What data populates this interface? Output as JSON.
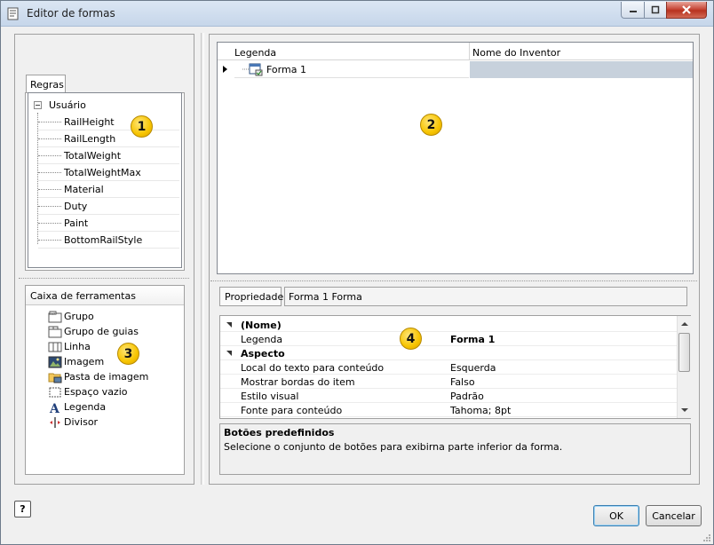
{
  "window": {
    "title": "Editor de formas",
    "icon": "form-editor-icon",
    "controls": [
      "minimize-icon",
      "maximize-icon",
      "close-icon"
    ]
  },
  "rules_panel": {
    "tab_label": "Regras",
    "tree_root": "Usuário",
    "items": [
      "RailHeight",
      "RailLength",
      "TotalWeight",
      "TotalWeightMax",
      "Material",
      "Duty",
      "Paint",
      "BottomRailStyle"
    ]
  },
  "toolbox": {
    "header": "Caixa de ferramentas",
    "items": [
      {
        "label": "Grupo",
        "icon": "group-icon"
      },
      {
        "label": "Grupo de guias",
        "icon": "tab-group-icon"
      },
      {
        "label": "Linha",
        "icon": "row-icon"
      },
      {
        "label": "Imagem",
        "icon": "image-icon"
      },
      {
        "label": "Pasta de imagem",
        "icon": "image-folder-icon"
      },
      {
        "label": "Espaço vazio",
        "icon": "empty-space-icon"
      },
      {
        "label": "Legenda",
        "icon": "label-icon"
      },
      {
        "label": "Divisor",
        "icon": "splitter-icon"
      }
    ]
  },
  "form_tree": {
    "columns": [
      "Legenda",
      "Nome do Inventor"
    ],
    "rows": [
      {
        "legend": "Forma 1",
        "inventor_name": ""
      }
    ]
  },
  "property_header": {
    "label": "Propriedade",
    "value": "Forma 1 Forma"
  },
  "property_grid": {
    "rows": [
      {
        "type": "category",
        "label": "(Nome)"
      },
      {
        "type": "property",
        "label": "Legenda",
        "value": "Forma 1",
        "bold": true
      },
      {
        "type": "category",
        "label": "Aspecto"
      },
      {
        "type": "property",
        "label": "Local do texto para conteúdo",
        "value": "Esquerda"
      },
      {
        "type": "property",
        "label": "Mostrar bordas do item",
        "value": "Falso"
      },
      {
        "type": "property",
        "label": "Estilo visual",
        "value": "Padrão"
      },
      {
        "type": "property",
        "label": "Fonte para conteúdo",
        "value": "Tahoma; 8pt"
      }
    ]
  },
  "description": {
    "title": "Botões predefinidos",
    "text": "Selecione o conjunto de botões para exibirna parte inferior da forma."
  },
  "callouts": [
    "1",
    "2",
    "3",
    "4"
  ],
  "buttons": {
    "ok": "OK",
    "cancel": "Cancelar",
    "help": "?"
  },
  "colors": {
    "callout": "#f7c400",
    "selected_cell": "#c7d1dc",
    "close_button": "#c7493a"
  }
}
